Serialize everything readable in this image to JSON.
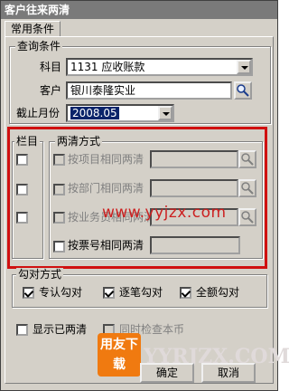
{
  "window": {
    "title": "客户往来两清"
  },
  "tab": {
    "label": "常用条件"
  },
  "query": {
    "group_label": "查询条件",
    "subject_label": "科目",
    "subject_value": "1131 应收账款",
    "customer_label": "客户",
    "customer_value": "银川泰隆实业",
    "cutoff_label": "截止月份",
    "cutoff_value": "2008.05"
  },
  "column": {
    "group_label": "栏目"
  },
  "method": {
    "group_label": "两清方式",
    "options": [
      {
        "label": "按项目相同两清",
        "enabled": false
      },
      {
        "label": "按部门相同两清",
        "enabled": false
      },
      {
        "label": "按业务员相同两清",
        "enabled": false
      },
      {
        "label": "按票号相同两清",
        "enabled": true
      }
    ]
  },
  "tick": {
    "group_label": "勾对方式",
    "options": [
      {
        "label": "专认勾对",
        "checked": true
      },
      {
        "label": "逐笔勾对",
        "checked": true
      },
      {
        "label": "全额勾对",
        "checked": true
      }
    ]
  },
  "bottom": {
    "show_cleared": "显示已两清",
    "check_currency": "同时检查本币"
  },
  "buttons": {
    "ok": "确定",
    "cancel": "取消"
  },
  "watermark": {
    "url": "www.yyjzx.com",
    "brand": "YYRJZX.COM",
    "logo_text": "用友下载"
  },
  "colors": {
    "highlight": "#d01010",
    "selection": "#0a246a",
    "logo": "#f07a10"
  }
}
